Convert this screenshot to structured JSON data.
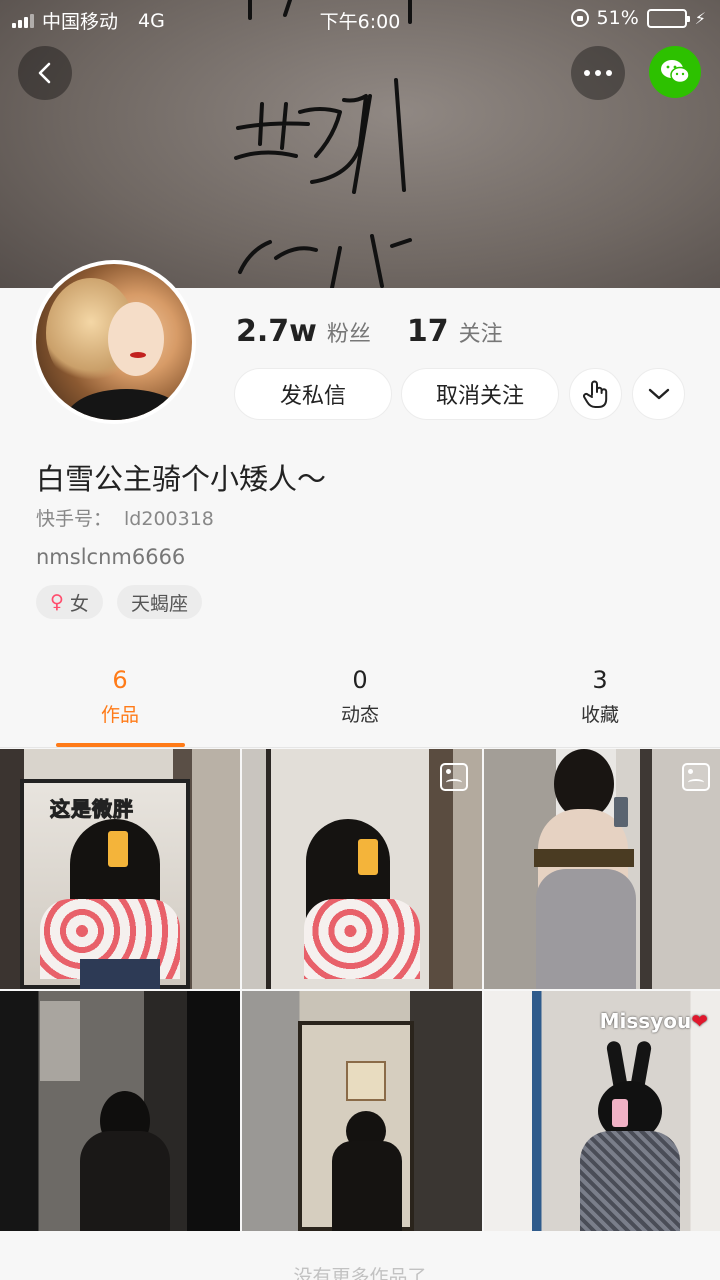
{
  "status_bar": {
    "carrier": "中国移动",
    "network": "4G",
    "time": "下午6:00",
    "battery": "51%",
    "battery_level": 0.51
  },
  "profile": {
    "fans_count": "2.7w",
    "fans_label": "粉丝",
    "following_count": "17",
    "following_label": "关注",
    "message_button": "发私信",
    "unfollow_button": "取消关注",
    "nickname": "白雪公主骑个小矮人～",
    "id_label": "快手号：",
    "id_value": "ld200318",
    "bio": "nmslcnm6666",
    "tags": [
      {
        "icon": "female-icon",
        "label": "女"
      },
      {
        "label": "天蝎座"
      }
    ]
  },
  "tabs": [
    {
      "count": "6",
      "label": "作品",
      "active": true
    },
    {
      "count": "0",
      "label": "动态",
      "active": false
    },
    {
      "count": "3",
      "label": "收藏",
      "active": false
    }
  ],
  "posts": [
    {
      "sticker": "这是微胖",
      "album": false
    },
    {
      "album": true
    },
    {
      "album": true
    },
    {
      "album": false
    },
    {
      "album": false
    },
    {
      "caption": "Missyou",
      "album": false
    }
  ],
  "footer": "没有更多作品了",
  "colors": {
    "accent": "#ff7b18",
    "wechat": "#2dc100",
    "battery_fill": "#4cd964"
  }
}
